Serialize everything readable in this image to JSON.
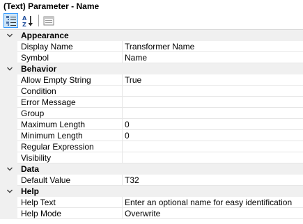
{
  "title": "(Text) Parameter - Name",
  "toolbar": {
    "categorized_icon": "categorized-icon",
    "alphabetical_icon": "alphabetical-icon",
    "property_pages_icon": "property-pages-icon"
  },
  "colors": {
    "gutter": "#f0f0f0",
    "active_button": "#cce4f7",
    "active_border": "#3399ff"
  },
  "categories": [
    {
      "name": "Appearance",
      "properties": [
        {
          "name": "Display Name",
          "value": "Transformer Name"
        },
        {
          "name": "Symbol",
          "value": "Name"
        }
      ]
    },
    {
      "name": "Behavior",
      "properties": [
        {
          "name": "Allow Empty String",
          "value": "True"
        },
        {
          "name": "Condition",
          "value": ""
        },
        {
          "name": "Error Message",
          "value": ""
        },
        {
          "name": "Group",
          "value": ""
        },
        {
          "name": "Maximum Length",
          "value": "0"
        },
        {
          "name": "Minimum Length",
          "value": "0"
        },
        {
          "name": "Regular Expression",
          "value": ""
        },
        {
          "name": "Visibility",
          "value": ""
        }
      ]
    },
    {
      "name": "Data",
      "properties": [
        {
          "name": "Default Value",
          "value": "T32"
        }
      ]
    },
    {
      "name": "Help",
      "properties": [
        {
          "name": "Help Text",
          "value": "Enter an optional name for easy identification"
        },
        {
          "name": "Help Mode",
          "value": "Overwrite"
        }
      ]
    }
  ]
}
